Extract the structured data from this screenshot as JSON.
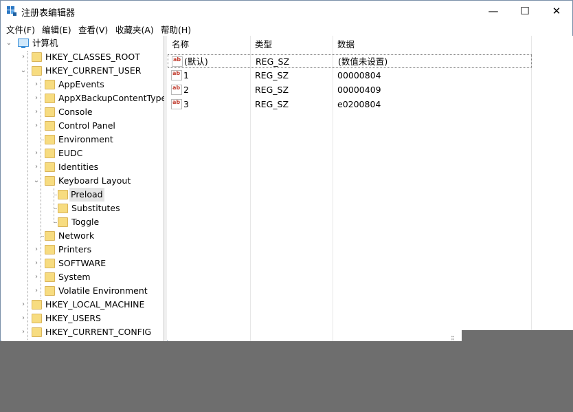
{
  "window": {
    "title": "注册表编辑器",
    "controls": {
      "minimize": "—",
      "maximize": "☐",
      "close": "✕"
    }
  },
  "menu": [
    "文件(F)",
    "编辑(E)",
    "查看(V)",
    "收藏夹(A)",
    "帮助(H)"
  ],
  "tree": {
    "root": "计算机",
    "hkcr": "HKEY_CLASSES_ROOT",
    "hkcu": "HKEY_CURRENT_USER",
    "hkcu_children": [
      "AppEvents",
      "AppXBackupContentType",
      "Console",
      "Control Panel",
      "Environment",
      "EUDC",
      "Identities",
      "Keyboard Layout"
    ],
    "kl_children": [
      "Preload",
      "Substitutes",
      "Toggle"
    ],
    "hkcu_more": [
      "Network",
      "Printers",
      "SOFTWARE",
      "System",
      "Volatile Environment"
    ],
    "hklm": "HKEY_LOCAL_MACHINE",
    "hku": "HKEY_USERS",
    "hkcc": "HKEY_CURRENT_CONFIG"
  },
  "list": {
    "columns": [
      "名称",
      "类型",
      "数据"
    ],
    "rows": [
      {
        "name": "(默认)",
        "type": "REG_SZ",
        "data": "(数值未设置)"
      },
      {
        "name": "1",
        "type": "REG_SZ",
        "data": "00000804"
      },
      {
        "name": "2",
        "type": "REG_SZ",
        "data": "00000409"
      },
      {
        "name": "3",
        "type": "REG_SZ",
        "data": "e0200804"
      }
    ],
    "value_icon": "ab"
  },
  "colors": {
    "folder": "#f7dc80",
    "selection": "#e5e5e5",
    "desktop": "#6e6e6e"
  }
}
